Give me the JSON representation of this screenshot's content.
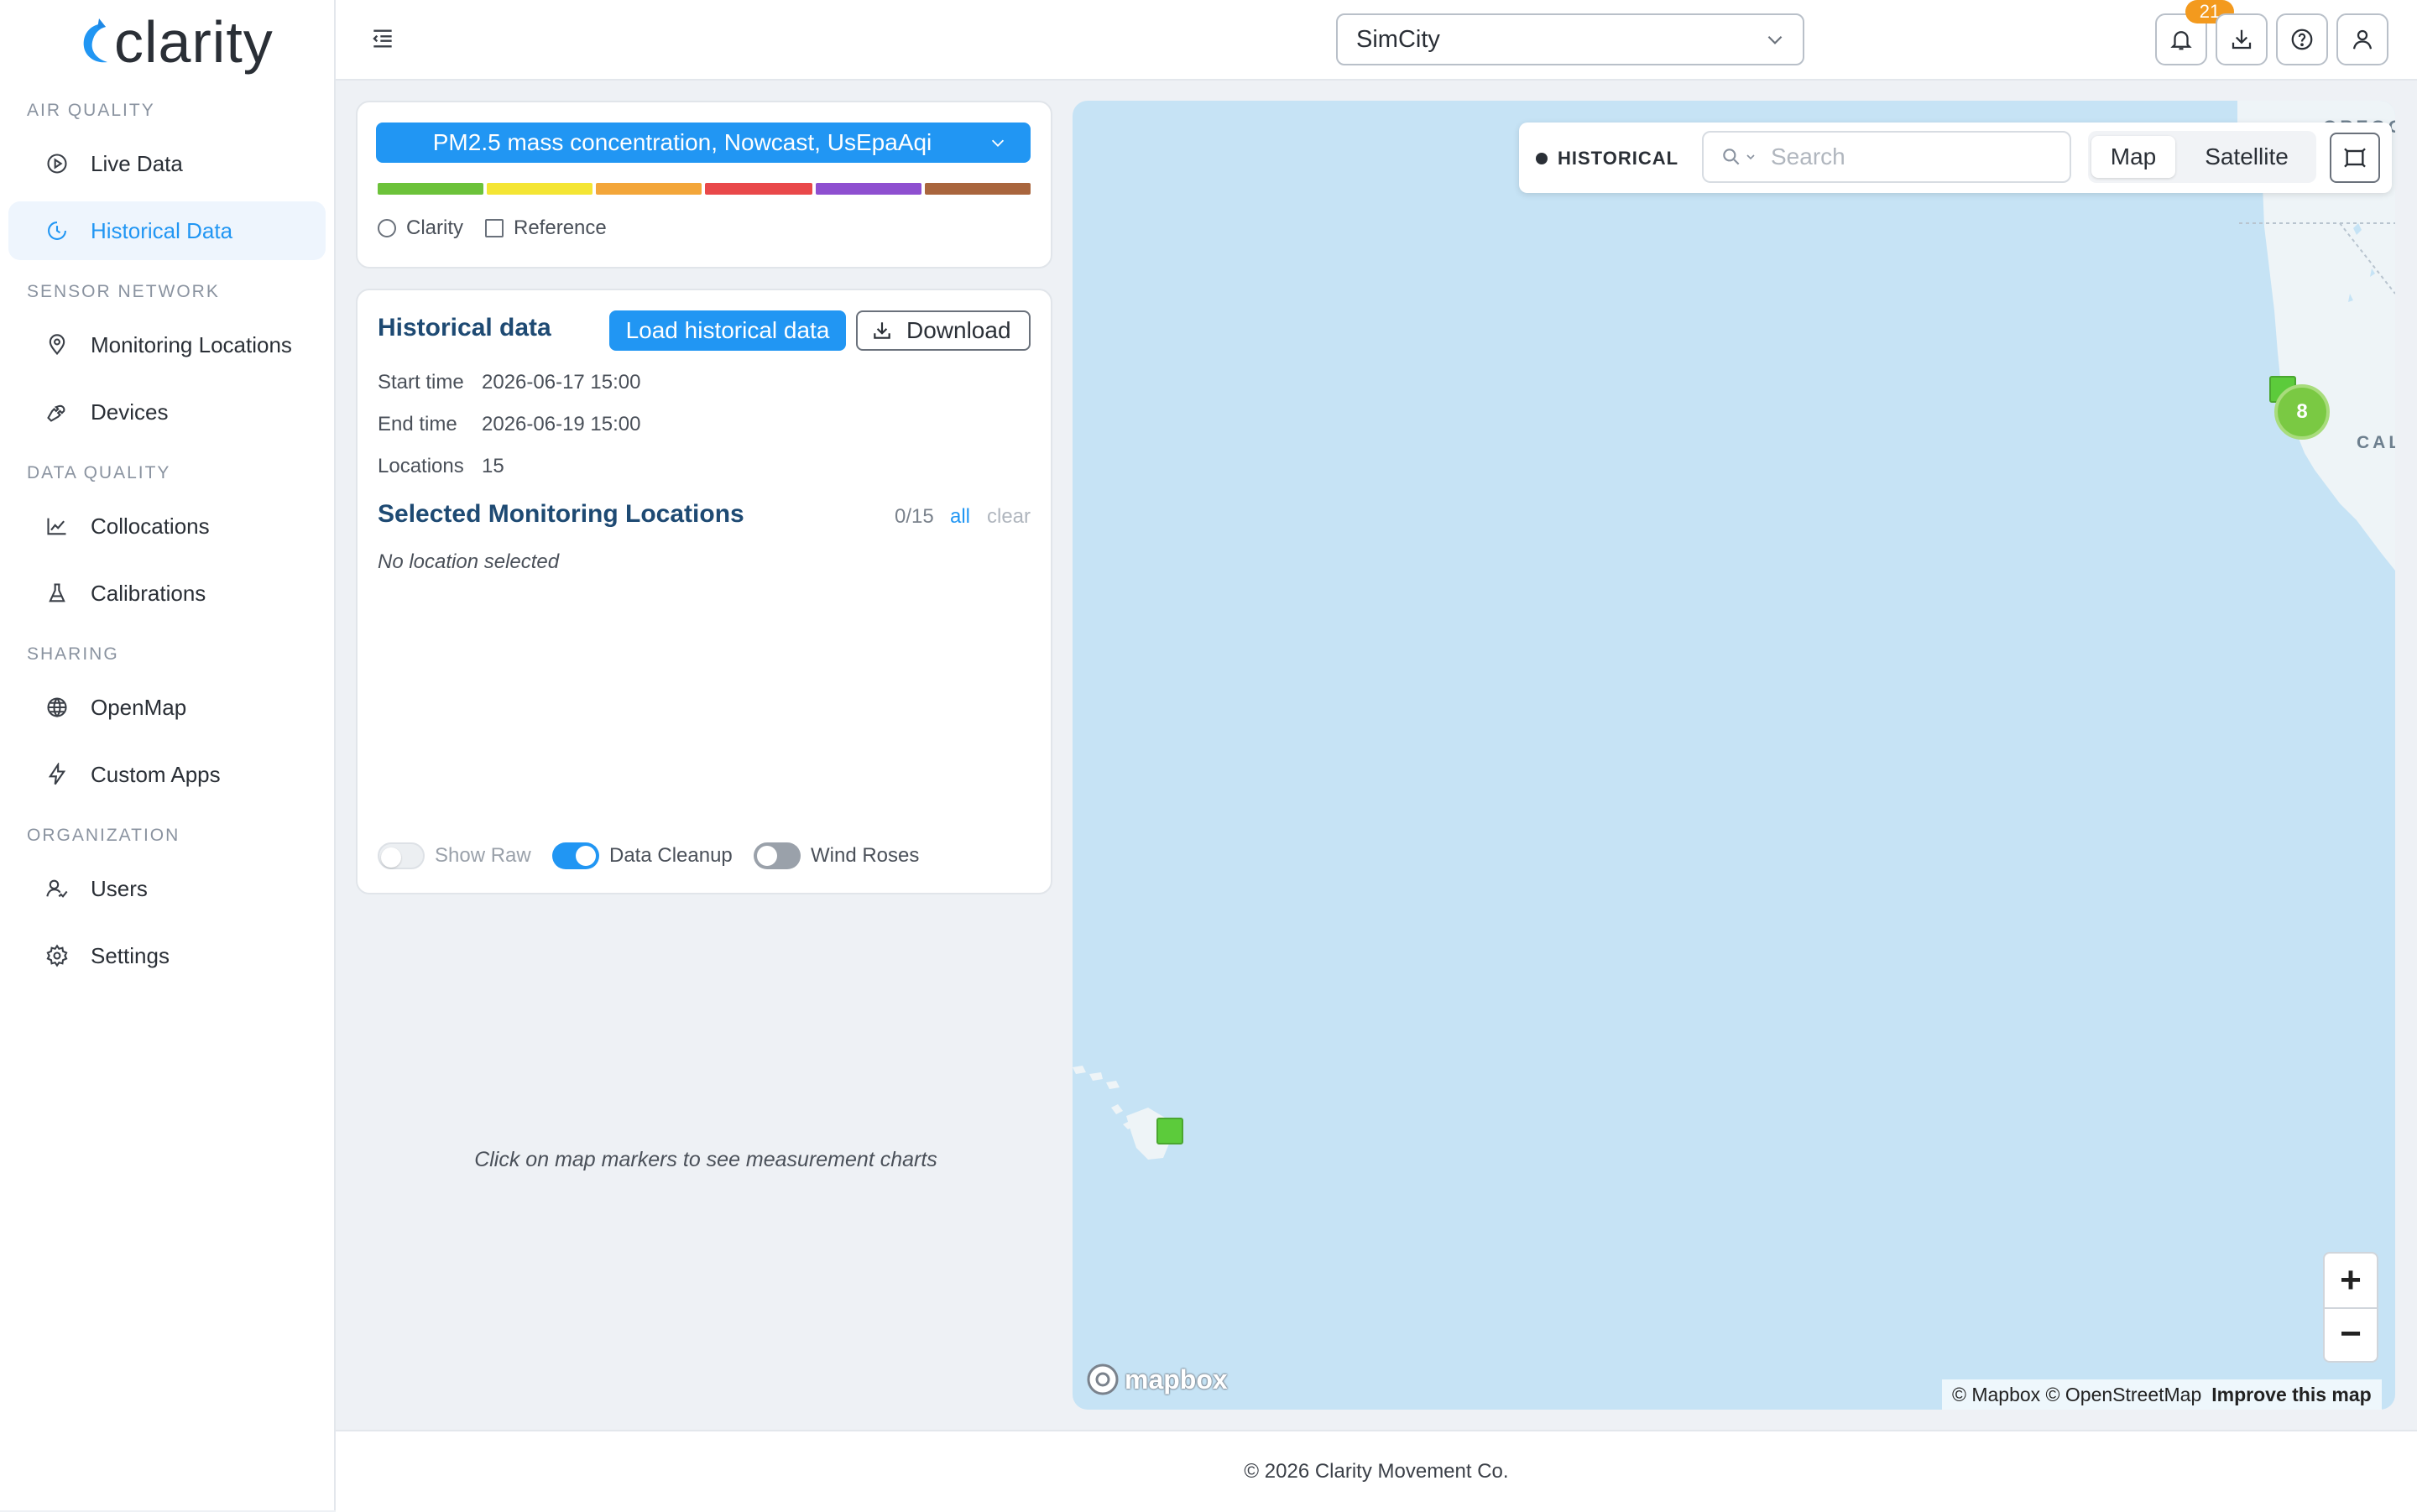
{
  "app": {
    "logo_text": "clarity"
  },
  "sidebar": {
    "sections": [
      {
        "label": "AIR QUALITY"
      },
      {
        "label": "SENSOR NETWORK"
      },
      {
        "label": "DATA QUALITY"
      },
      {
        "label": "SHARING"
      },
      {
        "label": "ORGANIZATION"
      }
    ],
    "items": [
      {
        "label": "Live Data",
        "icon": "play-circle-icon"
      },
      {
        "label": "Historical Data",
        "icon": "clock-icon",
        "active": true
      },
      {
        "label": "Monitoring Locations",
        "icon": "location-pin-icon"
      },
      {
        "label": "Devices",
        "icon": "wrench-icon"
      },
      {
        "label": "Collocations",
        "icon": "line-chart-icon"
      },
      {
        "label": "Calibrations",
        "icon": "flask-icon"
      },
      {
        "label": "OpenMap",
        "icon": "globe-icon"
      },
      {
        "label": "Custom Apps",
        "icon": "lightning-icon"
      },
      {
        "label": "Users",
        "icon": "users-icon"
      },
      {
        "label": "Settings",
        "icon": "gear-icon"
      }
    ]
  },
  "topbar": {
    "org_select": "SimCity",
    "notification_count": "21"
  },
  "metric_panel": {
    "selected_metric": "PM2.5 mass concentration, Nowcast, UsEpaAqi",
    "aqi_colors": [
      "#6cc23a",
      "#f4e534",
      "#f3a63a",
      "#e9484a",
      "#8e4fd0",
      "#a9653d"
    ],
    "options": {
      "clarity": "Clarity",
      "reference": "Reference"
    }
  },
  "historical_panel": {
    "title": "Historical data",
    "load_button": "Load historical data",
    "download_button": "Download",
    "start_label": "Start time",
    "start_value": "2026-06-17 15:00",
    "end_label": "End time",
    "end_value": "2026-06-19 15:00",
    "locations_label": "Locations",
    "locations_value": "15",
    "selected_title": "Selected Monitoring Locations",
    "selected_count": "0/15",
    "all_link": "all",
    "clear_link": "clear",
    "no_selection": "No location selected",
    "toggles": {
      "show_raw": {
        "label": "Show Raw",
        "on": false
      },
      "data_cleanup": {
        "label": "Data Cleanup",
        "on": true
      },
      "wind_roses": {
        "label": "Wind Roses",
        "on": false
      }
    }
  },
  "hint": "Click on map markers to see measurement charts",
  "map": {
    "mode_badge": "HISTORICAL",
    "search_placeholder": "Search",
    "view_map": "Map",
    "view_satellite": "Satellite",
    "cluster_count": "8",
    "label_california": "CALIFO",
    "label_oregon": "OREGO",
    "zoom_in": "+",
    "zoom_out": "−",
    "mapbox_logo": "mapbox",
    "attribution": "© Mapbox © OpenStreetMap",
    "improve": "Improve this map",
    "water_color": "#c6e3f5",
    "land_color": "#eef4f7"
  },
  "footer": {
    "copyright": "© 2026 Clarity Movement Co."
  }
}
